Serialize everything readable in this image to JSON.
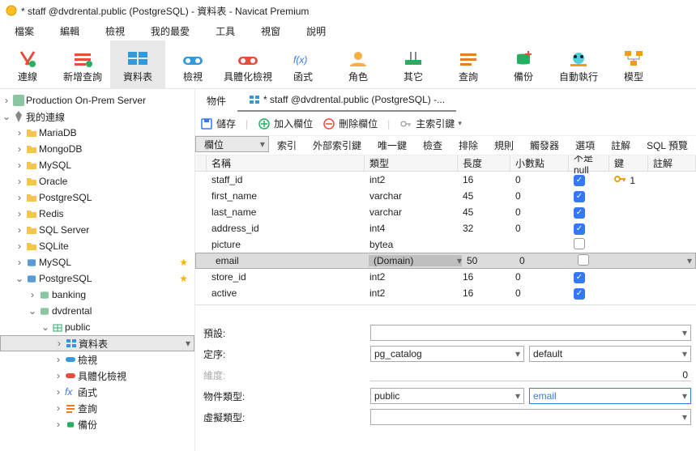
{
  "title": "* staff @dvdrental.public (PostgreSQL) - 資料表 - Navicat Premium",
  "menu": [
    "檔案",
    "編輯",
    "檢視",
    "我的最愛",
    "工具",
    "視窗",
    "說明"
  ],
  "tool": [
    "連線",
    "新增查詢",
    "資料表",
    "檢視",
    "具體化檢視",
    "函式",
    "角色",
    "其它",
    "查詢",
    "備份",
    "自動執行",
    "模型"
  ],
  "sidebar": {
    "root1": "Production On-Prem Server",
    "root2": "我的連線",
    "items": [
      "MariaDB",
      "MongoDB",
      "MySQL",
      "Oracle",
      "PostgreSQL",
      "Redis",
      "SQL Server",
      "SQLite",
      "MySQL",
      "PostgreSQL"
    ],
    "sub1": "banking",
    "sub2": "dvdrental",
    "sub3": "public",
    "leaf": [
      "資料表",
      "檢視",
      "具體化檢視",
      "函式",
      "查詢",
      "備份"
    ]
  },
  "tabs": {
    "t1": "物件",
    "t2": "* staff @dvdrental.public (PostgreSQL) -..."
  },
  "actions": {
    "save": "儲存",
    "add": "加入欄位",
    "del": "刪除欄位",
    "idx": "主索引鍵"
  },
  "sub": [
    "欄位",
    "索引",
    "外部索引鍵",
    "唯一鍵",
    "檢查",
    "排除",
    "規則",
    "觸發器",
    "選項",
    "註解",
    "SQL 預覽"
  ],
  "cols": {
    "name": "名稱",
    "type": "類型",
    "len": "長度",
    "dec": "小數點",
    "nn": "不是 null",
    "key": "鍵",
    "com": "註解"
  },
  "rows": [
    {
      "n": "staff_id",
      "t": "int2",
      "l": "16",
      "d": "0",
      "nn": true,
      "k": "1"
    },
    {
      "n": "first_name",
      "t": "varchar",
      "l": "45",
      "d": "0",
      "nn": true
    },
    {
      "n": "last_name",
      "t": "varchar",
      "l": "45",
      "d": "0",
      "nn": true
    },
    {
      "n": "address_id",
      "t": "int4",
      "l": "32",
      "d": "0",
      "nn": true
    },
    {
      "n": "picture",
      "t": "bytea",
      "l": "",
      "d": "",
      "nn": false
    },
    {
      "n": "email",
      "t": "(Domain)",
      "l": "50",
      "d": "0",
      "nn": false,
      "sel": true
    },
    {
      "n": "store_id",
      "t": "int2",
      "l": "16",
      "d": "0",
      "nn": true
    },
    {
      "n": "active",
      "t": "int2",
      "l": "16",
      "d": "0",
      "nn": true
    }
  ],
  "form": {
    "def": "預設:",
    "coll": "定序:",
    "dim": "維度:",
    "dimv": "0",
    "objt": "物件類型:",
    "virt": "虛擬類型:",
    "coll1": "pg_catalog",
    "coll2": "default",
    "objt1": "public",
    "objt2": "email"
  }
}
